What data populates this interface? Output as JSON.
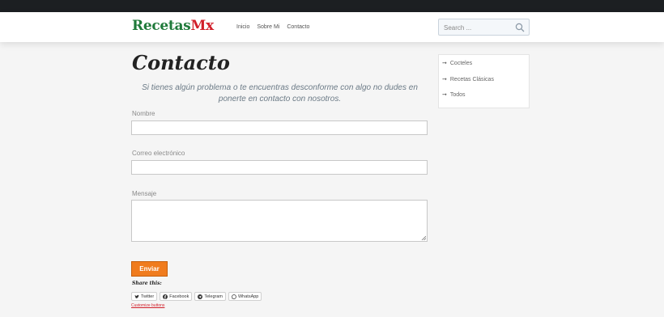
{
  "header": {
    "logo_part1": "Recetas",
    "logo_part2": "Mx",
    "nav": [
      "Inicio",
      "Sobre Mi",
      "Contacto"
    ],
    "search_placeholder": "Search ...",
    "search_icon": "search-icon"
  },
  "page": {
    "title": "Contacto",
    "intro": "Si tienes algún problema o te encuentras desconforme con algo no dudes en ponerte en contacto con nosotros."
  },
  "form": {
    "name_label": "Nombre",
    "email_label": "Correo electrónico",
    "message_label": "Mensaje",
    "submit_label": "Enviar"
  },
  "share": {
    "title": "Share this:",
    "buttons": [
      {
        "label": "Twitter",
        "icon": "twitter-icon"
      },
      {
        "label": "Facebook",
        "icon": "facebook-icon"
      },
      {
        "label": "Telegram",
        "icon": "telegram-icon"
      },
      {
        "label": "WhatsApp",
        "icon": "whatsapp-icon"
      }
    ],
    "customize": "Customize buttons"
  },
  "sidebar": {
    "items": [
      "Cocteles",
      "Recetas Clásicas",
      "Todos"
    ]
  },
  "colors": {
    "topbar": "#1c1f22",
    "logo_green": "#1f7a3a",
    "logo_red": "#d11f2a",
    "button_orange": "#f07c1e"
  }
}
